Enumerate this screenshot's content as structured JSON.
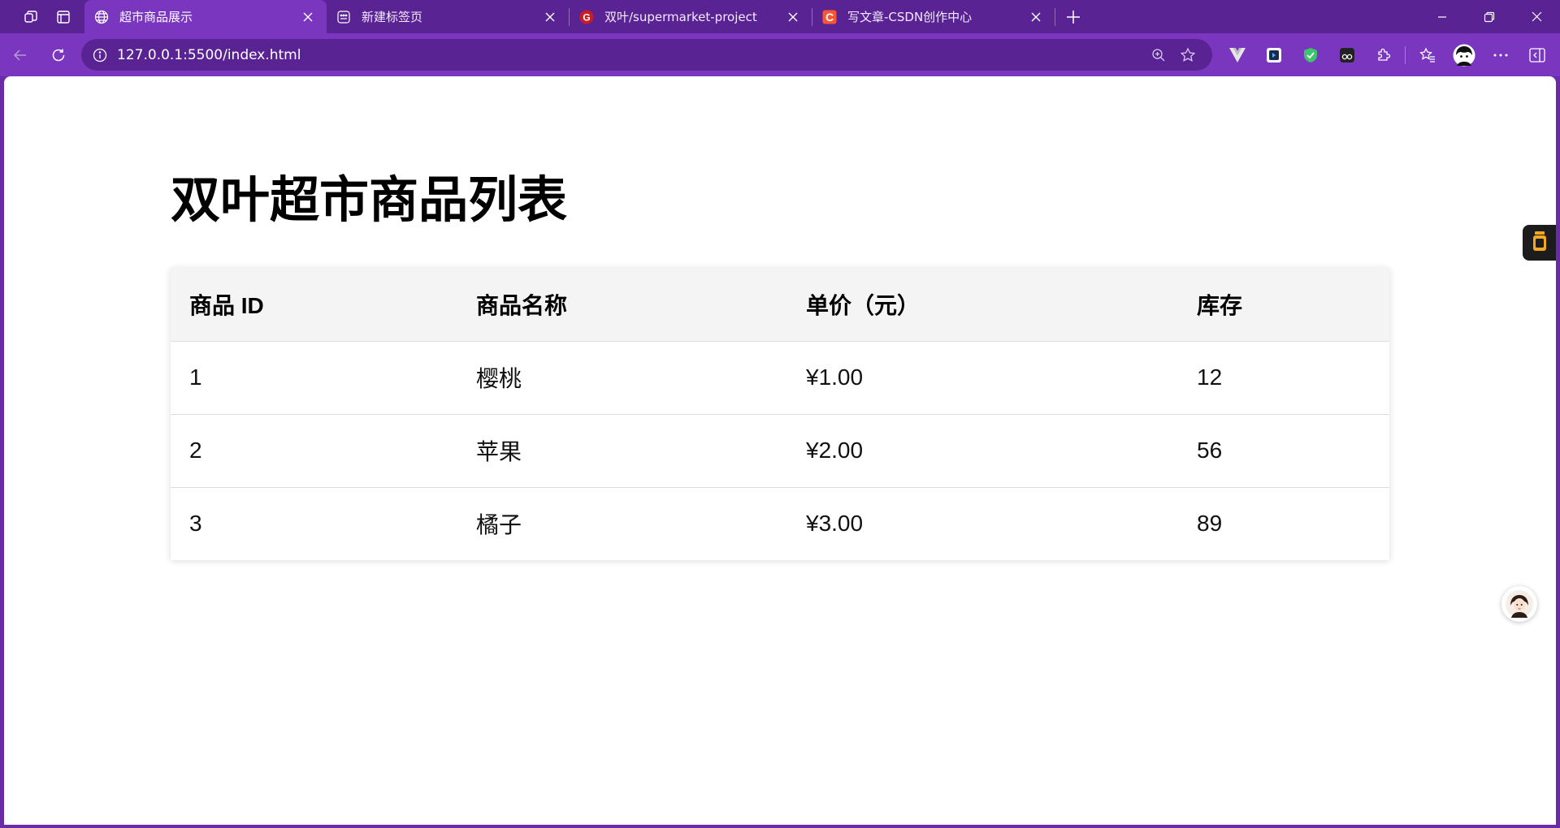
{
  "window": {
    "tabs": [
      {
        "title": "超市商品展示",
        "favicon": "globe-icon",
        "active": true
      },
      {
        "title": "新建标签页",
        "favicon": "newtab-grid-icon",
        "active": false
      },
      {
        "title": "双叶/supermarket-project",
        "favicon": "gitee-icon",
        "active": false
      },
      {
        "title": "写文章-CSDN创作中心",
        "favicon": "csdn-icon",
        "active": false
      }
    ],
    "frame_color": "#5a2394",
    "accent_color": "#7a36be"
  },
  "address_bar": {
    "url": "127.0.0.1:5500/index.html"
  },
  "page": {
    "heading": "双叶超市商品列表",
    "table": {
      "headers": [
        "商品 ID",
        "商品名称",
        "单价（元）",
        "库存"
      ],
      "rows": [
        [
          "1",
          "樱桃",
          "¥1.00",
          "12"
        ],
        [
          "2",
          "苹果",
          "¥2.00",
          "56"
        ],
        [
          "3",
          "橘子",
          "¥3.00",
          "89"
        ]
      ]
    }
  }
}
